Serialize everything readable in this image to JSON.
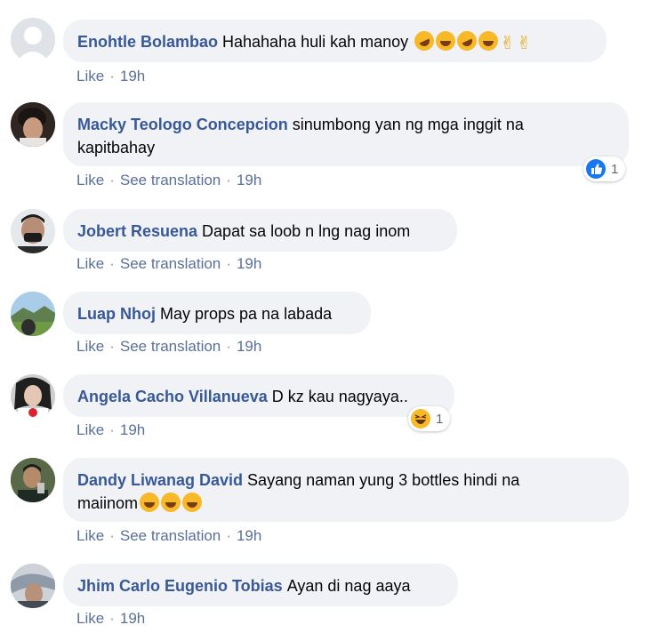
{
  "comments": [
    {
      "author": "Enohtle Bolambao",
      "text": "Hahahaha huli kah manoy",
      "emojis": [
        "rofl",
        "laugh",
        "rofl",
        "laugh",
        "victory",
        "victory"
      ],
      "actions": {
        "like": "Like",
        "time": "19h"
      }
    },
    {
      "author": "Macky Teologo Concepcion",
      "text": "sinumbong yan ng mga inggit na",
      "text2": "kapitbahay",
      "actions": {
        "like": "Like",
        "translate": "See translation",
        "time": "19h"
      },
      "reaction": {
        "type": "like",
        "count": "1"
      }
    },
    {
      "author": "Jobert Resuena",
      "text": "Dapat sa loob n lng nag inom",
      "actions": {
        "like": "Like",
        "translate": "See translation",
        "time": "19h"
      }
    },
    {
      "author": "Luap Nhoj",
      "text": "May props pa na labada",
      "actions": {
        "like": "Like",
        "translate": "See translation",
        "time": "19h"
      }
    },
    {
      "author": "Angela Cacho Villanueva",
      "text": "D kz kau nagyaya..",
      "actions": {
        "like": "Like",
        "time": "19h"
      },
      "reaction": {
        "type": "haha",
        "count": "1"
      }
    },
    {
      "author": "Dandy Liwanag David",
      "text": "Sayang naman yung 3 bottles hindi na",
      "text2": "maiinom",
      "emojis": [
        "laugh",
        "laugh",
        "laugh"
      ],
      "actions": {
        "like": "Like",
        "translate": "See translation",
        "time": "19h"
      }
    },
    {
      "author": "Jhim Carlo Eugenio Tobias",
      "text": "Ayan di nag aaya",
      "actions": {
        "like": "Like",
        "time": "19h"
      }
    }
  ],
  "colors": {
    "author": "#385898",
    "bubble": "#f0f2f5",
    "meta": "#5a6f9a",
    "like_blue": "#1877f2",
    "emoji_yellow": "#f7b928"
  }
}
